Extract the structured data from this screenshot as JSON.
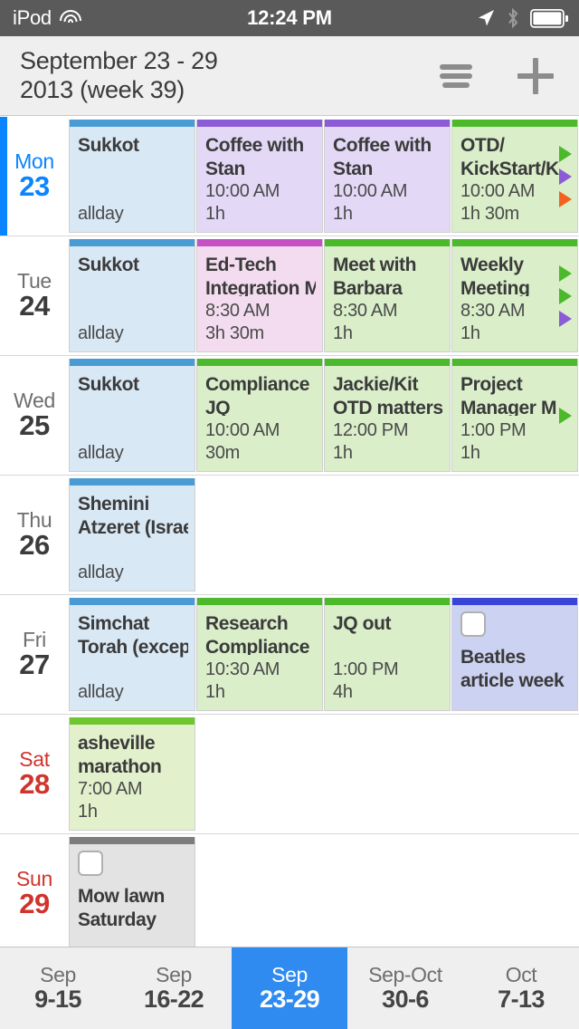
{
  "statusbar": {
    "carrier": "iPod",
    "time": "12:24 PM",
    "icons": [
      "wifi-icon",
      "location-arrow-icon",
      "bluetooth-icon",
      "battery-icon"
    ]
  },
  "header": {
    "title_line1": "September 23 - 29",
    "title_line2": "2013 (week 39)",
    "menu_icon": "hamburger-menu-icon",
    "add_icon": "plus-icon"
  },
  "colors": {
    "today_accent": "#0a84ff",
    "weekend_text": "#d0342c",
    "selected_week": "#2f8bf0",
    "cal_blue_bar": "#4a9ad4",
    "cal_blue_body": "#d9e8f5",
    "cal_purple_bar": "#8b5cd6",
    "cal_purple_body": "#e3d9f7",
    "cal_magenta_bar": "#c452c4",
    "cal_magenta_body": "#f3dcf0",
    "cal_green_bar": "#4cb82c",
    "cal_green_body": "#d9eec9",
    "cal_indigo_bar": "#3a45d8",
    "cal_indigo_body": "#ccd2f2",
    "cal_gray_bar": "#7d7d7d",
    "cal_gray_body": "#e3e3e3"
  },
  "days": [
    {
      "dow": "Mon",
      "num": "23",
      "today": true,
      "weekend": false,
      "arrows": [
        "#4cb82c",
        "#8b5cd6",
        "#f4621f"
      ],
      "events": [
        {
          "title": "Sukkot",
          "time": "",
          "dur": "",
          "allday": "allday",
          "bar": "#4a9ad4",
          "body": "#d9e8f5",
          "type": "event"
        },
        {
          "title": "Coffee with\nStan",
          "time": "10:00 AM",
          "dur": "1h",
          "allday": "",
          "bar": "#8b5cd6",
          "body": "#e3d9f7",
          "type": "event"
        },
        {
          "title": "Coffee with\nStan",
          "time": "10:00 AM",
          "dur": "1h",
          "allday": "",
          "bar": "#8b5cd6",
          "body": "#e3d9f7",
          "type": "event"
        },
        {
          "title": "OTD/\nKickStart/K",
          "time": "10:00 AM",
          "dur": "1h 30m",
          "allday": "",
          "bar": "#4cb82c",
          "body": "#d9eec9",
          "type": "event"
        }
      ]
    },
    {
      "dow": "Tue",
      "num": "24",
      "today": false,
      "weekend": false,
      "arrows": [
        "#4cb82c",
        "#4cb82c",
        "#8b5cd6"
      ],
      "events": [
        {
          "title": "Sukkot",
          "time": "",
          "dur": "",
          "allday": "allday",
          "bar": "#4a9ad4",
          "body": "#d9e8f5",
          "type": "event"
        },
        {
          "title": "Ed-Tech\nIntegration M",
          "time": "8:30 AM",
          "dur": "3h 30m",
          "allday": "",
          "bar": "#c452c4",
          "body": "#f3dcf0",
          "type": "event"
        },
        {
          "title": "Meet with\nBarbara",
          "time": "8:30 AM",
          "dur": "1h",
          "allday": "",
          "bar": "#4cb82c",
          "body": "#d9eec9",
          "type": "event"
        },
        {
          "title": "Weekly\nMeeting",
          "time": "8:30 AM",
          "dur": "1h",
          "allday": "",
          "bar": "#4cb82c",
          "body": "#d9eec9",
          "type": "event"
        }
      ]
    },
    {
      "dow": "Wed",
      "num": "25",
      "today": false,
      "weekend": false,
      "arrows": [
        "#4cb82c"
      ],
      "events": [
        {
          "title": "Sukkot",
          "time": "",
          "dur": "",
          "allday": "allday",
          "bar": "#4a9ad4",
          "body": "#d9e8f5",
          "type": "event"
        },
        {
          "title": "Compliance\nJQ",
          "time": "10:00 AM",
          "dur": "30m",
          "allday": "",
          "bar": "#4cb82c",
          "body": "#d9eec9",
          "type": "event"
        },
        {
          "title": "Jackie/Kit\nOTD matters",
          "time": "12:00 PM",
          "dur": "1h",
          "allday": "",
          "bar": "#4cb82c",
          "body": "#d9eec9",
          "type": "event"
        },
        {
          "title": "Project\nManager M",
          "time": "1:00 PM",
          "dur": "1h",
          "allday": "",
          "bar": "#4cb82c",
          "body": "#d9eec9",
          "type": "event"
        }
      ]
    },
    {
      "dow": "Thu",
      "num": "26",
      "today": false,
      "weekend": false,
      "arrows": [],
      "events": [
        {
          "title": "Shemini\nAtzeret (Israe",
          "time": "",
          "dur": "",
          "allday": "allday",
          "bar": "#4a9ad4",
          "body": "#d9e8f5",
          "type": "event"
        }
      ]
    },
    {
      "dow": "Fri",
      "num": "27",
      "today": false,
      "weekend": false,
      "arrows": [],
      "events": [
        {
          "title": "Simchat\nTorah (excep",
          "time": "",
          "dur": "",
          "allday": "allday",
          "bar": "#4a9ad4",
          "body": "#d9e8f5",
          "type": "event"
        },
        {
          "title": "Research\nCompliance",
          "time": "10:30 AM",
          "dur": "1h",
          "allday": "",
          "bar": "#4cb82c",
          "body": "#d9eec9",
          "type": "event"
        },
        {
          "title": "JQ out",
          "time": "1:00 PM",
          "dur": "4h",
          "allday": "",
          "bar": "#4cb82c",
          "body": "#d9eec9",
          "type": "event"
        },
        {
          "title": "Beatles\narticle week",
          "time": "",
          "dur": "",
          "allday": "",
          "bar": "#3a45d8",
          "body": "#ccd2f2",
          "type": "task"
        }
      ]
    },
    {
      "dow": "Sat",
      "num": "28",
      "today": false,
      "weekend": true,
      "arrows": [],
      "events": [
        {
          "title": "asheville\nmarathon",
          "time": "7:00 AM",
          "dur": "1h",
          "allday": "",
          "bar": "#6ec72e",
          "body": "#e2f0cc",
          "type": "event"
        }
      ]
    },
    {
      "dow": "Sun",
      "num": "29",
      "today": false,
      "weekend": true,
      "arrows": [],
      "events": [
        {
          "title": "Mow lawn\nSaturday",
          "time": "",
          "dur": "",
          "allday": "",
          "bar": "#7d7d7d",
          "body": "#e3e3e3",
          "type": "task"
        }
      ]
    }
  ],
  "weekbar": {
    "items": [
      {
        "month": "Sep",
        "days": "9-15",
        "active": false
      },
      {
        "month": "Sep",
        "days": "16-22",
        "active": false
      },
      {
        "month": "Sep",
        "days": "23-29",
        "active": true
      },
      {
        "month": "Sep-Oct",
        "days": "30-6",
        "active": false
      },
      {
        "month": "Oct",
        "days": "7-13",
        "active": false
      }
    ]
  }
}
